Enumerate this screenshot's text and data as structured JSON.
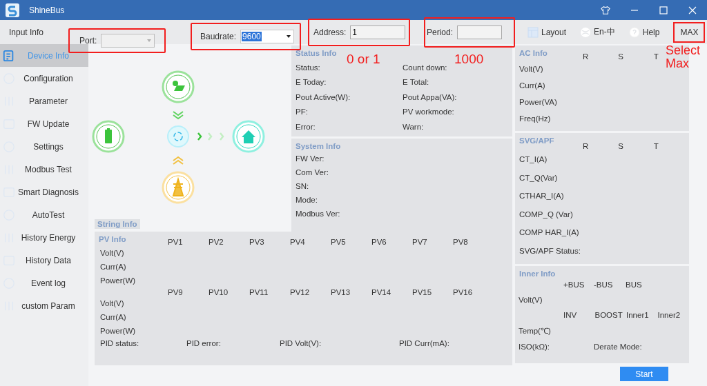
{
  "window": {
    "title": "ShineBus"
  },
  "toolbar": {
    "label": "Input Info",
    "fields": [
      {
        "kind": "combo",
        "label": "Port:",
        "disabled": true,
        "highlighted": true
      },
      {
        "kind": "combo",
        "label": "Baudrate:",
        "value": "9600",
        "value_selected": true,
        "disabled": false,
        "highlighted": true
      },
      {
        "kind": "text",
        "label": "Address:",
        "value": "1",
        "highlighted": true
      },
      {
        "kind": "text",
        "label": "Period:",
        "highlighted": true
      }
    ],
    "buttons": [
      {
        "kind": "layout",
        "label": "Layout",
        "highlighted": false
      },
      {
        "kind": "language",
        "label": "En-中",
        "highlighted": false
      },
      {
        "kind": "help",
        "label": "Help",
        "highlighted": false
      },
      {
        "kind": "plain",
        "label": "MAX",
        "highlighted": true
      }
    ]
  },
  "sidebar": {
    "items": [
      {
        "label": "Device Info",
        "selected": true
      },
      {
        "label": "Configuration",
        "selected": false
      },
      {
        "label": "Parameter",
        "selected": false
      },
      {
        "label": "FW Update",
        "selected": false
      },
      {
        "label": "Settings",
        "selected": false
      },
      {
        "label": "Modbus Test",
        "selected": false
      },
      {
        "label": "Smart Diagnosis",
        "selected": false
      },
      {
        "label": "AutoTest",
        "selected": false
      },
      {
        "label": "History Energy",
        "selected": false
      },
      {
        "label": "History Data",
        "selected": false
      },
      {
        "label": "Event log",
        "selected": false
      },
      {
        "label": "custom Param",
        "selected": false
      }
    ]
  },
  "status_info": {
    "title": "Status Info",
    "fields": [
      "Status:",
      "Count down:",
      "E Today:",
      "E Total:",
      "Pout Active(W):",
      "Pout Appa(VA):",
      "PF:",
      "PV workmode:",
      "Error:",
      "Warn:"
    ]
  },
  "system_info": {
    "title": "System Info",
    "fields": [
      "FW Ver:",
      "Com Ver:",
      "SN:",
      "Mode:",
      "Modbus Ver:"
    ]
  },
  "string_info": {
    "title": "String Info"
  },
  "pv_info": {
    "title": "PV Info",
    "groups": [
      {
        "columns": [
          "PV1",
          "PV2",
          "PV3",
          "PV4",
          "PV5",
          "PV6",
          "PV7",
          "PV8"
        ],
        "rows": [
          "Volt(V)",
          "Curr(A)",
          "Power(W)"
        ]
      },
      {
        "columns": [
          "PV9",
          "PV10",
          "PV11",
          "PV12",
          "PV13",
          "PV14",
          "PV15",
          "PV16"
        ],
        "rows": [
          "Volt(V)",
          "Curr(A)",
          "Power(W)"
        ]
      }
    ],
    "footer": [
      "PID status:",
      "PID error:",
      "PID Volt(V):",
      "PID Curr(mA):"
    ]
  },
  "ac_info": {
    "title": "AC Info",
    "columns": [
      "R",
      "S",
      "T"
    ],
    "rows": [
      "Volt(V)",
      "Curr(A)",
      "Power(VA)",
      "Freq(Hz)"
    ]
  },
  "svg_apf": {
    "title": "SVG/APF",
    "columns": [
      "R",
      "S",
      "T"
    ],
    "rows": [
      "CT_I(A)",
      "CT_Q(Var)",
      "CTHAR_I(A)",
      "COMP_Q (Var)",
      "COMP HAR_I(A)",
      "SVG/APF Status:"
    ]
  },
  "inner_info": {
    "title": "Inner Info",
    "bus_columns": [
      "+BUS",
      "-BUS",
      "BUS"
    ],
    "volt_label": "Volt(V)",
    "temp_columns": [
      "INV",
      "BOOST",
      "Inner1",
      "Inner2"
    ],
    "temp_label": "Temp(℃)",
    "iso_label": "ISO(kΩ):",
    "derate_label": "Derate Mode:"
  },
  "start_button": {
    "label": "Start"
  },
  "annotations": [
    "0 or 1",
    "1000",
    "Select Max"
  ]
}
